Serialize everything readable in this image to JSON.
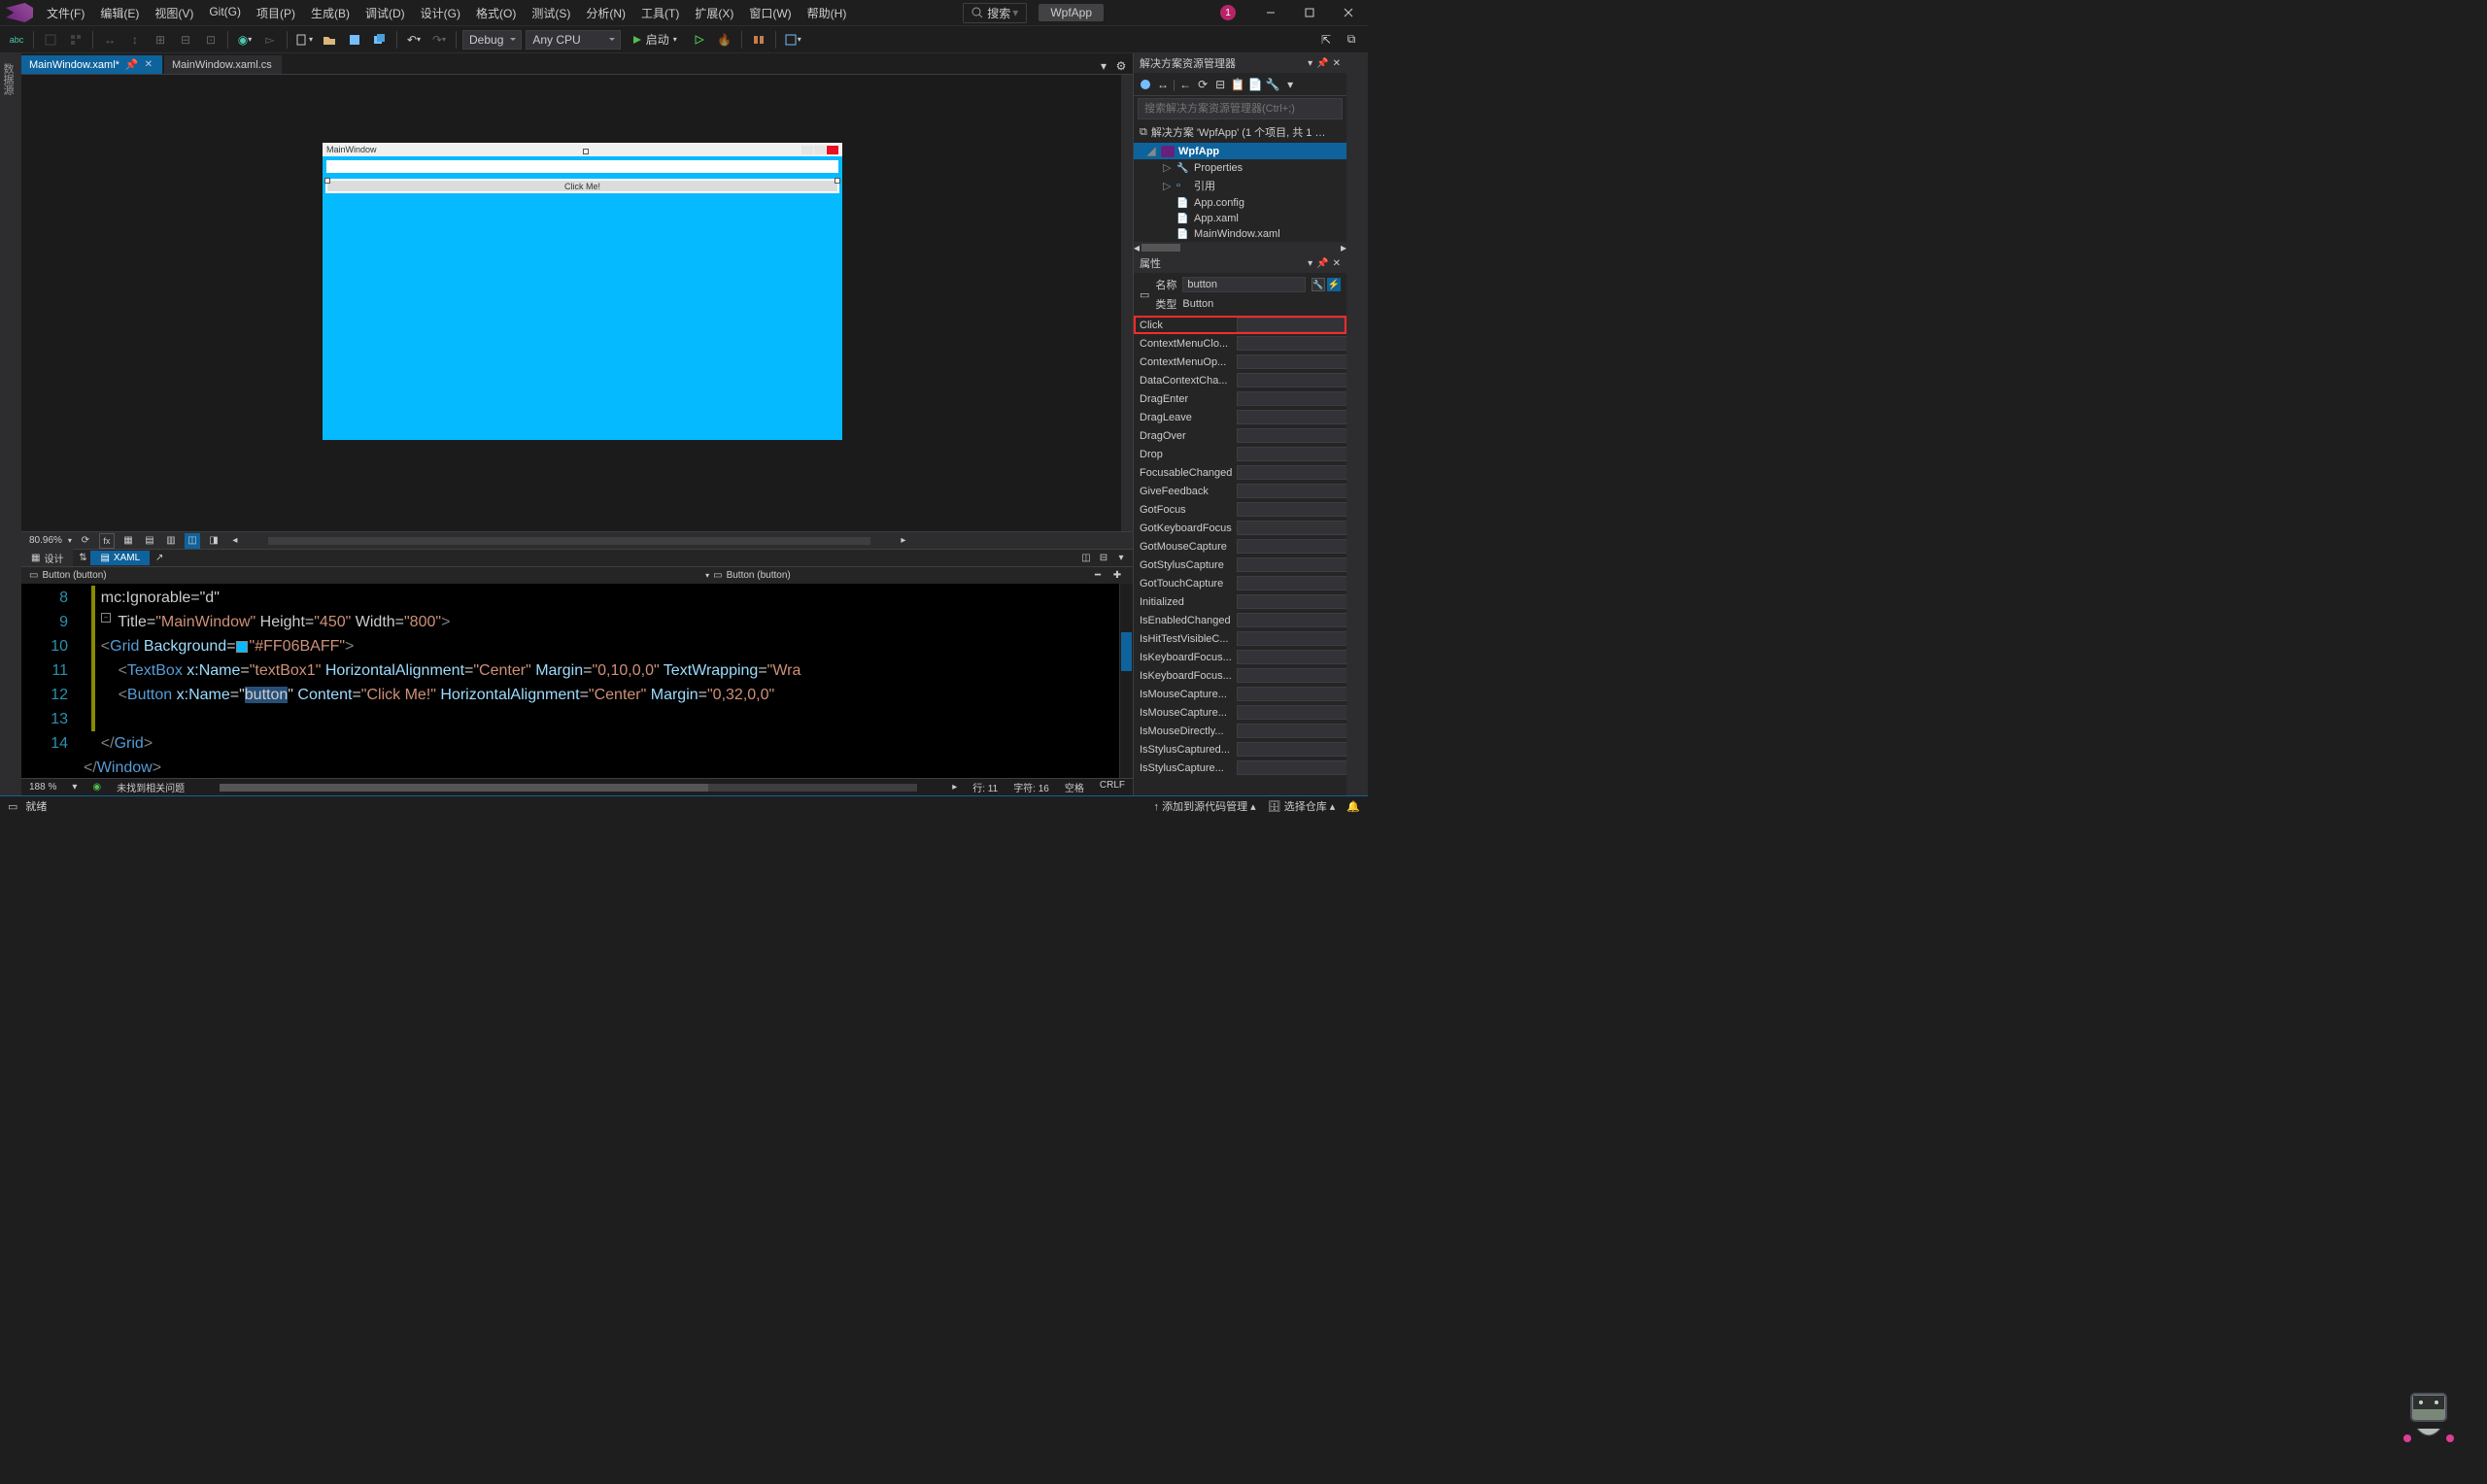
{
  "menubar": [
    "文件(F)",
    "编辑(E)",
    "视图(V)",
    "Git(G)",
    "项目(P)",
    "生成(B)",
    "调试(D)",
    "设计(G)",
    "格式(O)",
    "测试(S)",
    "分析(N)",
    "工具(T)",
    "扩展(X)",
    "窗口(W)",
    "帮助(H)"
  ],
  "search_placeholder": "搜索",
  "app_name": "WpfApp",
  "user_badge": "1",
  "toolbar": {
    "config": "Debug",
    "platform": "Any CPU",
    "start_label": "启动"
  },
  "tabs": [
    {
      "label": "MainWindow.xaml*",
      "active": true,
      "pinned": true
    },
    {
      "label": "MainWindow.xaml.cs",
      "active": false
    }
  ],
  "left_rail": "数据源",
  "designer": {
    "window_title": "MainWindow",
    "button_text": "Click Me!",
    "zoom": "80.96%"
  },
  "split_tabs": {
    "design": "设计",
    "xaml": "XAML"
  },
  "path_bar": {
    "left": "Button (button)",
    "right": "Button (button)"
  },
  "code": {
    "line_start": 8,
    "lines": [
      {
        "n": "",
        "html": "    mc:Ignorable=\"d\""
      },
      {
        "n": "8",
        "html": "        Title=<span class='k-str'>\"MainWindow\"</span> Height=<span class='k-str'>\"450\"</span> Width=<span class='k-str'>\"800\"</span><span class='k-punc'>&gt;</span>"
      },
      {
        "n": "9",
        "html": "    <span class='k-punc'>&lt;</span><span class='k-tag'>Grid</span> <span class='k-attr'>Background</span>=<span class='color-box'></span><span class='k-str'>\"#FF06BAFF\"</span><span class='k-punc'>&gt;</span>"
      },
      {
        "n": "10",
        "html": "        <span class='k-punc'>&lt;</span><span class='k-tag'>TextBox</span> <span class='k-attr'>x:Name</span>=<span class='k-str'>\"textBox1\"</span> <span class='k-attr'>HorizontalAlignment</span>=<span class='k-str'>\"Center\"</span> <span class='k-attr'>Margin</span>=<span class='k-str'>\"0,10,0,0\"</span> <span class='k-attr'>TextWrapping</span>=<span class='k-str'>\"Wra</span>"
      },
      {
        "n": "11",
        "html": "        <span class='k-punc'>&lt;</span><span class='k-tag'>Button</span> <span class='k-attr'>x:Name</span>=\"<span class='selection'>button</span>\" <span class='k-attr'>Content</span>=<span class='k-str'>\"Click Me!\"</span> <span class='k-attr'>HorizontalAlignment</span>=<span class='k-str'>\"Center\"</span> <span class='k-attr'>Margin</span>=<span class='k-str'>\"0,32,0,0\"</span> "
      },
      {
        "n": "12",
        "html": ""
      },
      {
        "n": "13",
        "html": "    <span class='k-punc'>&lt;/</span><span class='k-tag'>Grid</span><span class='k-punc'>&gt;</span>"
      },
      {
        "n": "14",
        "html": "<span class='k-punc'>&lt;/</span><span class='k-tag'>Window</span><span class='k-punc'>&gt;</span>"
      }
    ]
  },
  "editor_status": {
    "zoom": "188 %",
    "issues": "未找到相关问题",
    "ln": "行: 11",
    "col": "字符: 16",
    "ins": "空格",
    "eol": "CRLF"
  },
  "solution": {
    "title": "解决方案资源管理器",
    "search_placeholder": "搜索解决方案资源管理器(Ctrl+;)",
    "root": "解决方案 'WpfApp' (1 个项目, 共 1 …",
    "project": "WpfApp",
    "items": [
      "Properties",
      "引用",
      "App.config",
      "App.xaml",
      "MainWindow.xaml"
    ]
  },
  "properties": {
    "title": "属性",
    "name_label": "名称",
    "name_value": "button",
    "type_label": "类型",
    "type_value": "Button",
    "events": [
      "Click",
      "ContextMenuClo...",
      "ContextMenuOp...",
      "DataContextCha...",
      "DragEnter",
      "DragLeave",
      "DragOver",
      "Drop",
      "FocusableChanged",
      "GiveFeedback",
      "GotFocus",
      "GotKeyboardFocus",
      "GotMouseCapture",
      "GotStylusCapture",
      "GotTouchCapture",
      "Initialized",
      "IsEnabledChanged",
      "IsHitTestVisibleC...",
      "IsKeyboardFocus...",
      "IsKeyboardFocus...",
      "IsMouseCapture...",
      "IsMouseCapture...",
      "IsMouseDirectly...",
      "IsStylusCaptured...",
      "IsStylusCapture..."
    ]
  },
  "statusbar": {
    "ready": "就绪",
    "repo": "添加到源代码管理",
    "select": "选择仓库"
  }
}
